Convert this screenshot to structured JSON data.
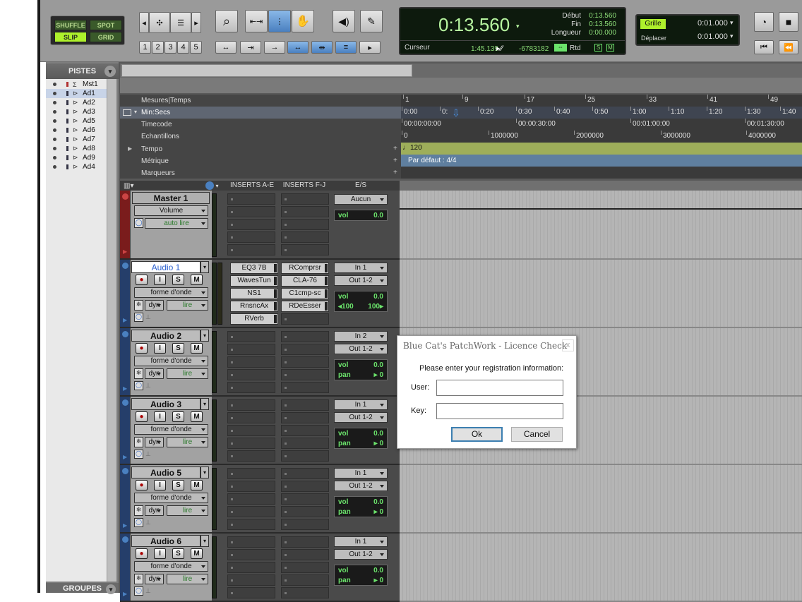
{
  "toolbar": {
    "modes": {
      "shuffle": "SHUFFLE",
      "spot": "SPOT",
      "slip": "SLIP",
      "grid": "GRID"
    },
    "zoom_presets": [
      "1",
      "2",
      "3",
      "4",
      "5"
    ],
    "counter": {
      "main": "0:13.560",
      "debut_label": "Début",
      "debut": "0:13.560",
      "fin_label": "Fin",
      "fin": "0:13.560",
      "longueur_label": "Longueur",
      "longueur": "0:00.000",
      "curseur_label": "Curseur",
      "curseur": "1:45.139",
      "samples": "-6783182",
      "rtd": "Rtd"
    },
    "grid": {
      "grille_label": "Grille",
      "grille_value": "0:01.000",
      "deplacer_label": "Déplacer",
      "deplacer_value": "0:01.000"
    }
  },
  "pistes": {
    "header": "PISTES",
    "groupes": "GROUPES",
    "items": [
      {
        "name": "Mst1"
      },
      {
        "name": "Ad1"
      },
      {
        "name": "Ad2"
      },
      {
        "name": "Ad3"
      },
      {
        "name": "Ad5"
      },
      {
        "name": "Ad6"
      },
      {
        "name": "Ad7"
      },
      {
        "name": "Ad8"
      },
      {
        "name": "Ad9"
      },
      {
        "name": "Ad4"
      }
    ]
  },
  "rulers": {
    "mesures": {
      "label": "Mesures|Temps",
      "ticks": [
        "1",
        "9",
        "17",
        "25",
        "33",
        "41",
        "49"
      ]
    },
    "minsecs": {
      "label": "Min:Secs",
      "ticks": [
        "0:00",
        "0:",
        "0:20",
        "0:30",
        "0:40",
        "0:50",
        "1:00",
        "1:10",
        "1:20",
        "1:30",
        "1:40"
      ]
    },
    "timecode": {
      "label": "Timecode",
      "ticks": [
        "00:00:00:00",
        "00:00:30:00",
        "00:01:00:00",
        "00:01:30:00"
      ]
    },
    "echantillons": {
      "label": "Echantillons",
      "ticks": [
        "0",
        "1000000",
        "2000000",
        "3000000",
        "4000000"
      ]
    },
    "tempo": {
      "label": "Tempo",
      "value": "120"
    },
    "metrique": {
      "label": "Métrique",
      "value": "Par défaut : 4/4"
    },
    "marqueurs": {
      "label": "Marqueurs"
    }
  },
  "columns": {
    "inserts_ae": "INSERTS A-E",
    "inserts_fj": "INSERTS F-J",
    "es": "E/S"
  },
  "master": {
    "name": "Master 1",
    "view": "Volume",
    "auto": "auto lire",
    "output": "Aucun",
    "vol_label": "vol",
    "vol": "0.0"
  },
  "tracks": [
    {
      "name": "Audio 1",
      "view": "forme d'onde",
      "dyn": "dyn",
      "auto": "lire",
      "in": "In 1",
      "out": "Out 1-2",
      "vol_label": "vol",
      "vol": "0.0",
      "pan_l": "100",
      "pan_r": "100",
      "inserts_ae": [
        "EQ3 7B",
        "WavesTun",
        "NS1",
        "RnsncAx",
        "RVerb"
      ],
      "inserts_fj": [
        "RComprsr",
        "CLA-76",
        "C1cmp-sc",
        "RDeEsser"
      ]
    },
    {
      "name": "Audio 2",
      "view": "forme d'onde",
      "dyn": "dyn",
      "auto": "lire",
      "in": "In 2",
      "out": "Out 1-2",
      "vol_label": "vol",
      "vol": "0.0",
      "pan_label": "pan",
      "pan": "0"
    },
    {
      "name": "Audio 3",
      "view": "forme d'onde",
      "dyn": "dyn",
      "auto": "lire",
      "in": "In 1",
      "out": "Out 1-2",
      "vol_label": "vol",
      "vol": "0.0",
      "pan_label": "pan",
      "pan": "0"
    },
    {
      "name": "Audio 5",
      "view": "forme d'onde",
      "dyn": "dyn",
      "auto": "lire",
      "in": "In 1",
      "out": "Out 1-2",
      "vol_label": "vol",
      "vol": "0.0",
      "pan_label": "pan",
      "pan": "0"
    },
    {
      "name": "Audio 6",
      "view": "forme d'onde",
      "dyn": "dyn",
      "auto": "lire",
      "in": "In 1",
      "out": "Out 1-2",
      "vol_label": "vol",
      "vol": "0.0",
      "pan_label": "pan",
      "pan": "0"
    }
  ],
  "track_buttons": {
    "rec": "",
    "input": "I",
    "solo": "S",
    "mute": "M"
  },
  "dialog": {
    "title": "Blue Cat's PatchWork - Licence Check",
    "close": "x",
    "prompt": "Please enter your registration information:",
    "user_label": "User:",
    "key_label": "Key:",
    "user_value": "",
    "key_value": "",
    "ok": "Ok",
    "cancel": "Cancel"
  }
}
